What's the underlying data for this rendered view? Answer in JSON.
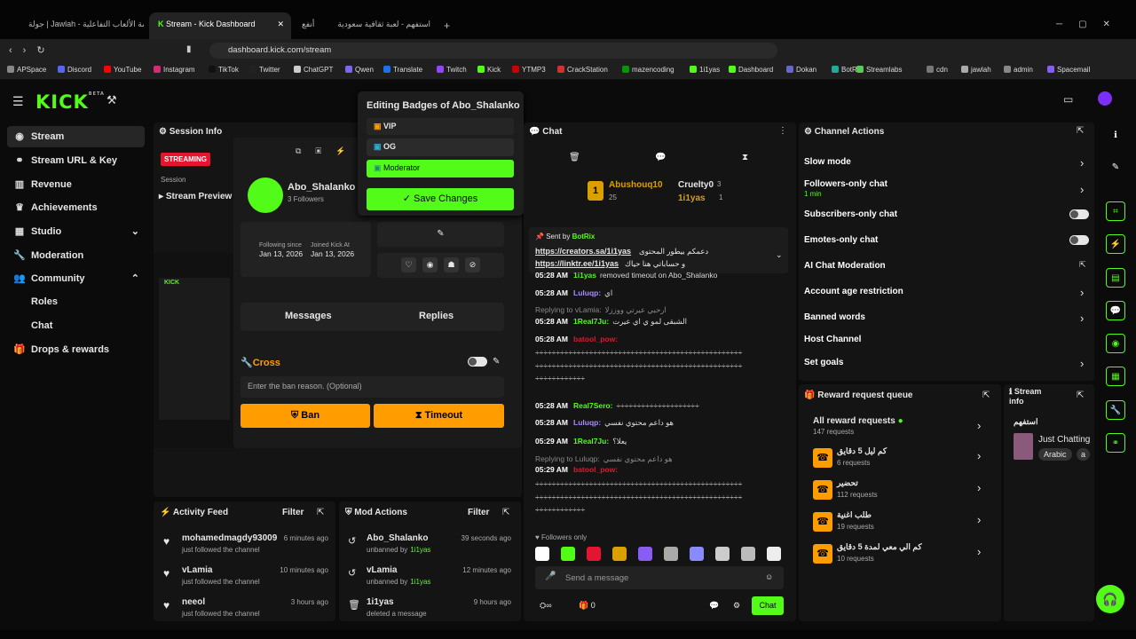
{
  "browser": {
    "tabs": [
      "جولة | Jawlah - منصة الألعاب التفاعلية",
      "Stream - Kick Dashboard",
      "استفهم - لعبة ثقافية سعودية",
      "أنفع"
    ],
    "url": "dashboard.kick.com/stream",
    "bookmarks": [
      "APSpace",
      "Discord",
      "YouTube",
      "Instagram",
      "TikTok",
      "Twitter",
      "ChatGPT",
      "Qwen",
      "Translate",
      "Twitch",
      "Kick",
      "YTMP3",
      "CrackStation",
      "mazencoding",
      "1i1yas",
      "Dashboard",
      "Dokan",
      "BotRix",
      "Streamlabs",
      "cdn",
      "jawlah",
      "admin",
      "Spacemail"
    ]
  },
  "brand": {
    "logo": "KICK",
    "beta": "BETA"
  },
  "sidebar": {
    "items": [
      "Stream",
      "Stream URL & Key",
      "Revenue",
      "Achievements",
      "Studio",
      "Moderation",
      "Community",
      "Roles",
      "Chat",
      "Drops & rewards"
    ]
  },
  "session": {
    "title": "Session Info",
    "status": "STREAMING",
    "sub": "Session"
  },
  "preview": {
    "title": "Stream Preview"
  },
  "user_card": {
    "name": "Abo_Shalanko",
    "followers": "3 Followers",
    "following_label": "Following since",
    "following_date": "Jan 13, 2026",
    "joined_label": "Joined Kick At",
    "joined_date": "Jan 13, 2026",
    "tab_messages": "Messages",
    "tab_replies": "Replies",
    "section": "Cross",
    "ban_placeholder": "Enter the ban reason. (Optional)",
    "ban": "Ban",
    "timeout": "Timeout"
  },
  "badges": {
    "title": "Editing Badges of Abo_Shalanko",
    "vip": "VIP",
    "og": "OG",
    "moderator": "Moderator",
    "save": "Save Changes"
  },
  "chat": {
    "title": "Chat",
    "gifter1": "Abushouq10",
    "gifter1_count": "25",
    "gifter2": "Cruelty0",
    "gifter2_count": "3",
    "gifter3": "1i1yas",
    "gifter3_count": "1",
    "pinned_by": "Sent by",
    "pinned_user": "BotRix",
    "pinned_link1": "https://creators.sa/1i1yas",
    "pinned_text1": "دعمكم بيطور المحتوى",
    "pinned_link2": "https://linktr.ee/1i1yas",
    "pinned_text2": "و حساباتي هنا حياك",
    "messages": [
      {
        "t": "05:28 AM",
        "u": "1i1yas",
        "m": "removed timeout on Abo_Shalanko"
      },
      {
        "t": "05:28 AM",
        "u": "Luluqp:",
        "m": "اي"
      },
      {
        "t": "",
        "u": "Replying to vLamia:",
        "m": "ارحبي عيرتي ووززلا"
      },
      {
        "t": "05:28 AM",
        "u": "1Real7Ju:",
        "m": "الشبقى لمو ي اي عيرت"
      },
      {
        "t": "05:28 AM",
        "u": "batool_pow:",
        "m": ""
      },
      {
        "t": "",
        "u": "",
        "m": "÷÷÷÷÷÷÷÷÷÷÷÷÷÷÷÷÷÷÷÷÷÷÷÷÷÷÷÷÷÷÷÷÷÷÷÷÷÷÷÷÷÷÷÷÷÷÷÷÷÷"
      },
      {
        "t": "",
        "u": "",
        "m": "÷÷÷÷÷÷÷÷÷÷÷÷÷÷÷÷÷÷÷÷÷÷÷÷÷÷÷÷÷÷÷÷÷÷÷÷÷÷÷÷÷÷÷÷÷÷÷÷÷÷"
      },
      {
        "t": "",
        "u": "",
        "m": "÷÷÷÷÷÷÷÷÷÷÷÷"
      },
      {
        "t": "05:28 AM",
        "u": "Real7Sero:",
        "m": "÷÷÷÷÷÷÷÷÷÷÷÷÷÷÷÷÷÷÷÷"
      },
      {
        "t": "05:28 AM",
        "u": "Luluqp:",
        "m": "هو داعم محتوي نفسي"
      },
      {
        "t": "05:29 AM",
        "u": "1Real7Ju:",
        "m": "يعلا؟"
      },
      {
        "t": "",
        "u": "Replying to Luluqp:",
        "m": "هو داعم محتوي نفسي"
      },
      {
        "t": "05:29 AM",
        "u": "batool_pow:",
        "m": ""
      },
      {
        "t": "",
        "u": "",
        "m": "÷÷÷÷÷÷÷÷÷÷÷÷÷÷÷÷÷÷÷÷÷÷÷÷÷÷÷÷÷÷÷÷÷÷÷÷÷÷÷÷÷÷÷÷÷÷÷÷÷÷"
      },
      {
        "t": "",
        "u": "",
        "m": "÷÷÷÷÷÷÷÷÷÷÷÷÷÷÷÷÷÷÷÷÷÷÷÷÷÷÷÷÷÷÷÷÷÷÷÷÷÷÷÷÷÷÷÷÷÷÷÷÷÷"
      },
      {
        "t": "",
        "u": "",
        "m": "÷÷÷÷÷÷÷÷÷÷÷÷"
      }
    ],
    "followers_only": "Followers only",
    "placeholder": "Send a message",
    "count": "0",
    "send": "Chat"
  },
  "actions": {
    "title": "Channel Actions",
    "slow": "Slow mode",
    "followers": "Followers-only chat",
    "followers_sub": "1 min",
    "subs": "Subscribers-only chat",
    "emotes": "Emotes-only chat",
    "ai": "AI Chat Moderation",
    "age": "Account age restriction",
    "banned": "Banned words",
    "host": "Host Channel",
    "goals": "Set goals"
  },
  "rewards": {
    "title": "Reward request queue",
    "all": "All reward requests",
    "all_count": "147 requests",
    "items": [
      {
        "n": "كم ليل 5 دقايق",
        "c": "6 requests"
      },
      {
        "n": "تحضير",
        "c": "112 requests"
      },
      {
        "n": "طلب اغنية",
        "c": "19 requests"
      },
      {
        "n": "كم الي معي لمدة 5 دقايق",
        "c": "10 requests"
      }
    ]
  },
  "stream_info": {
    "title": "Stream info",
    "game": "استفهم",
    "status": "Just Chatting",
    "lang": "Arabic",
    "tag": "a"
  },
  "activity": {
    "title": "Activity Feed",
    "filter": "Filter",
    "items": [
      {
        "u": "mohamedmagdy93009",
        "t": "6 minutes ago",
        "a": "just followed the channel"
      },
      {
        "u": "vLamia",
        "t": "10 minutes ago",
        "a": "just followed the channel"
      },
      {
        "u": "neeol",
        "t": "3 hours ago",
        "a": "just followed the channel"
      }
    ]
  },
  "modactions": {
    "title": "Mod Actions",
    "filter": "Filter",
    "items": [
      {
        "u": "Abo_Shalanko",
        "t": "39 seconds ago",
        "a": "unbanned by",
        "by": "1i1yas"
      },
      {
        "u": "vLamia",
        "t": "12 minutes ago",
        "a": "unbanned by",
        "by": "1i1yas"
      },
      {
        "u": "1i1yas",
        "t": "9 hours ago",
        "a": "deleted a message",
        "by": ""
      }
    ]
  },
  "colors": {
    "accent": "#53fc18",
    "orange": "#ff9d00"
  }
}
